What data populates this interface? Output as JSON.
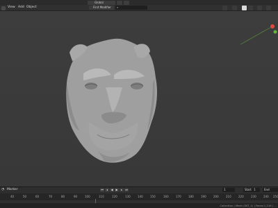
{
  "header": {
    "menus": [
      "View",
      "Add",
      "Object"
    ],
    "mode_label": "Global",
    "view_label": "First Modifier"
  },
  "timeline": {
    "marker_label": "Marker",
    "ticks": [
      "40",
      "50",
      "60",
      "70",
      "80",
      "90",
      "100",
      "110",
      "120",
      "130",
      "140",
      "150",
      "160",
      "170",
      "180",
      "190",
      "200",
      "210",
      "220",
      "230",
      "240",
      "250"
    ],
    "current_frame": "1",
    "start_label": "Start",
    "start_value": "1",
    "end_label": "End"
  },
  "status": {
    "right_text": "Collection | Mesh (SKT_1) | Faces:1,216 | ..."
  },
  "colors": {
    "accent_blue": "#3a70c6",
    "viewport_bg": "#3b3b3b",
    "axis_red": "#e0493f",
    "axis_green": "#68b13b",
    "axis_blue": "#3e7be0"
  }
}
